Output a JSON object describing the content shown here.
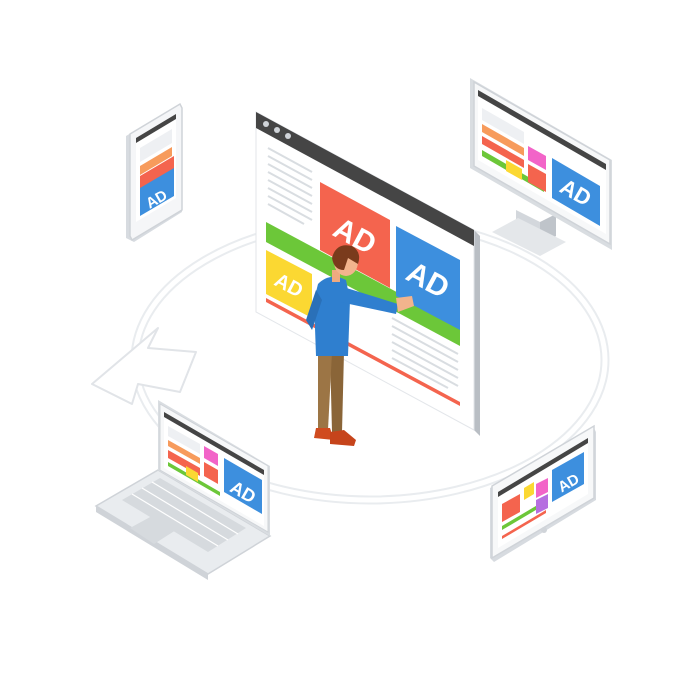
{
  "ads": {
    "main_red": "AD",
    "main_blue": "AD",
    "main_yellow": "AD",
    "phone": "AD",
    "monitor": "AD",
    "laptop": "AD",
    "tablet": "AD"
  },
  "colors": {
    "red": "#f4644e",
    "blue": "#3d8fde",
    "yellow": "#fbd832",
    "green": "#6cc739",
    "pink": "#f264c8",
    "orange": "#f79b5c",
    "purple": "#b66fe0",
    "bezel_dark": "#454545",
    "shirt": "#2f7fcf",
    "pants": "#9c7545",
    "shoes": "#d04b1f"
  },
  "icons": [
    "circular-arrow-icon",
    "smartphone-icon",
    "desktop-monitor-icon",
    "laptop-icon",
    "tablet-icon",
    "person-icon"
  ]
}
